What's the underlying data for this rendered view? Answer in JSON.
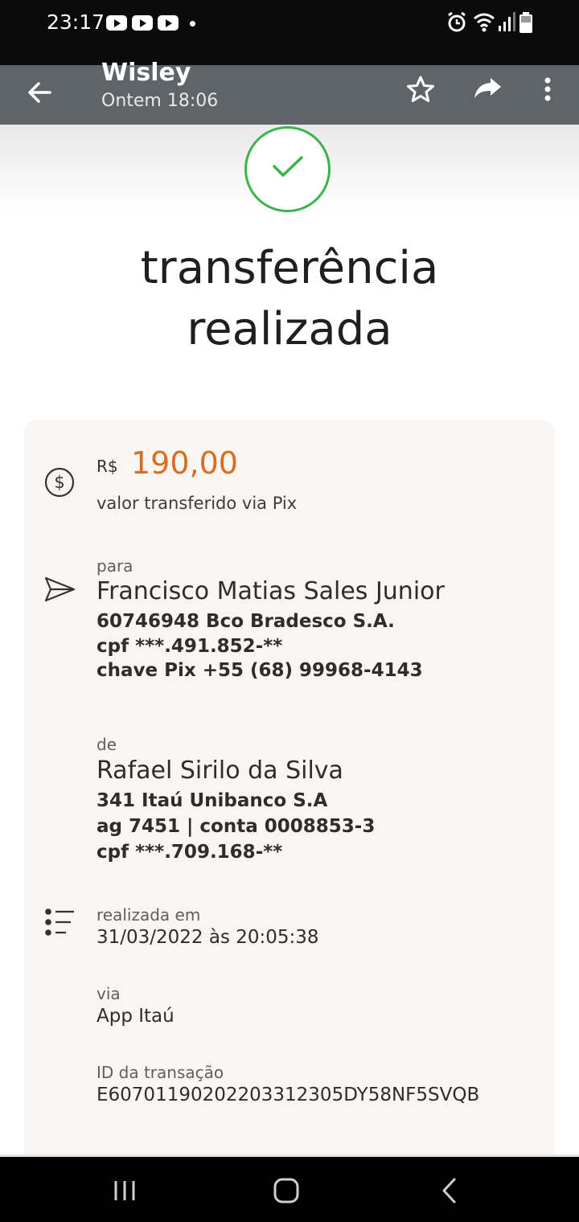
{
  "status_bar": {
    "time": "23:17",
    "notification_icons": [
      "youtube-icon",
      "youtube-icon",
      "youtube-icon"
    ],
    "system_icons": [
      "alarm-icon",
      "wifi-icon",
      "signal-icon",
      "battery-icon"
    ]
  },
  "app_bar": {
    "title": "Wisley",
    "subtitle": "Ontem 18:06",
    "actions": [
      "back-arrow-icon",
      "star-icon",
      "forward-icon",
      "more-vert-icon"
    ]
  },
  "receipt": {
    "status_icon": "check-icon",
    "status_color": "#3cb44b",
    "heading_line1": "transferência",
    "heading_line2": "realizada",
    "amount": {
      "currency": "R$",
      "value": "190,00",
      "color": "#d86e1f",
      "caption": "valor transferido via Pix"
    },
    "to": {
      "label": "para",
      "name": "Francisco Matias Sales Junior",
      "bank": "60746948 Bco Bradesco S.A.",
      "cpf": "cpf ***.491.852-**",
      "pix_key": "chave Pix +55 (68) 99968-4143"
    },
    "from": {
      "label": "de",
      "name": "Rafael Sirilo da Silva",
      "bank": "341 Itaú Unibanco S.A",
      "account": "ag 7451 | conta 0008853-3",
      "cpf": "cpf ***.709.168-**"
    },
    "date": {
      "label": "realizada em",
      "value": "31/03/2022 às 20:05:38"
    },
    "via": {
      "label": "via",
      "value": "App Itaú"
    },
    "transaction": {
      "label": "ID da transação",
      "value": "E60701190202203312305DY58NF5SVQB"
    }
  },
  "nav_bar": {
    "buttons": [
      "recents-icon",
      "home-icon",
      "back-icon"
    ]
  }
}
